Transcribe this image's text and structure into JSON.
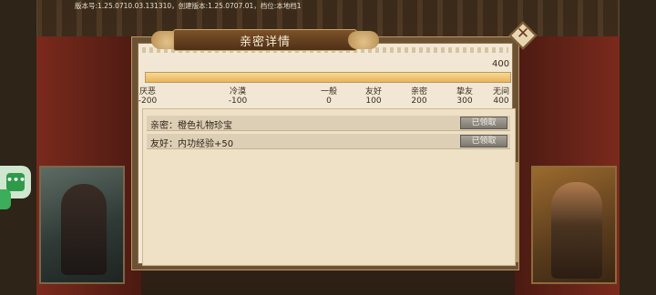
{
  "version_info": "版本号:1.25.0710.03.131310，创建版本:1.25.0707.01，档位:本地档1",
  "dialog": {
    "title": "亲密详情",
    "close_glyph": "✕",
    "progress": {
      "max_label": "400",
      "fraction": 1.0
    }
  },
  "tiers": [
    {
      "name": "厌恶",
      "value": "-200"
    },
    {
      "name": "冷漠",
      "value": "-100"
    },
    {
      "name": "一般",
      "value": "0"
    },
    {
      "name": "友好",
      "value": "100"
    },
    {
      "name": "亲密",
      "value": "200"
    },
    {
      "name": "挚友",
      "value": "300"
    },
    {
      "name": "无间",
      "value": "400"
    }
  ],
  "rewards": [
    {
      "label": "亲密：橙色礼物珍宝",
      "button": "已领取"
    },
    {
      "label": "友好：内功经验+50",
      "button": "已领取"
    }
  ],
  "float_button": {
    "glyph": "•••"
  },
  "icons": {
    "close": "close-icon",
    "float": "chat-bubble-icon"
  }
}
